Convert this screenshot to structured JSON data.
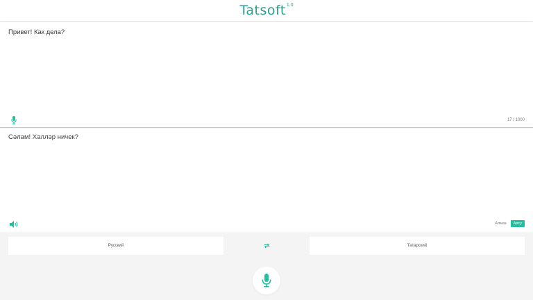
{
  "header": {
    "logo_text": "Tatsoft",
    "logo_version": "1.0"
  },
  "source": {
    "text": "Привет! Как дела?",
    "char_count": "17 / 1000",
    "mic_icon": "microphone-icon"
  },
  "target": {
    "text": "Сәлам! Хәлләр ничек?",
    "speaker_icon": "speaker-icon",
    "voices": [
      {
        "label": "Алмаз",
        "active": false
      },
      {
        "label": "Алсу",
        "active": true
      }
    ]
  },
  "languages": {
    "source_label": "Русский",
    "target_label": "Татарский",
    "swap_icon": "swap-arrows-icon"
  },
  "main_mic": {
    "icon": "microphone-icon"
  },
  "colors": {
    "accent": "#22c0a0",
    "logo": "#2a9d8f",
    "divider": "#9bdcc9",
    "background": "#f4f4f4"
  }
}
